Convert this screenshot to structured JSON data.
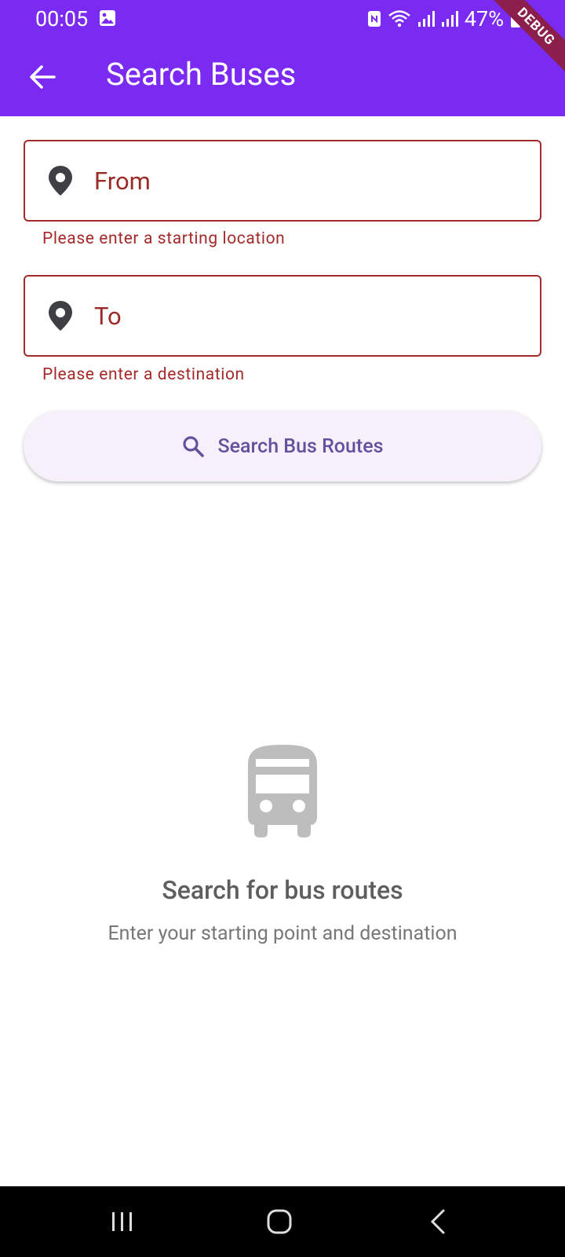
{
  "status_bar": {
    "time": "00:05",
    "battery": "47%",
    "debug_label": "DEBUG",
    "icons": [
      "image-icon",
      "nfc-icon",
      "wifi-icon",
      "signal-icon",
      "signal-icon",
      "battery-icon"
    ]
  },
  "app_bar": {
    "title": "Search Buses",
    "back_icon": "arrow-left-icon",
    "background_color": "#7b2af2"
  },
  "form": {
    "from": {
      "placeholder": "From",
      "value": "",
      "error": "Please enter a starting location",
      "icon": "location-pin-icon"
    },
    "to": {
      "placeholder": "To",
      "value": "",
      "error": "Please enter a destination",
      "icon": "location-pin-icon"
    },
    "error_color": "#a52a2a",
    "search_button": {
      "label": "Search Bus Routes",
      "icon": "search-icon"
    }
  },
  "empty_state": {
    "icon": "bus-icon",
    "title": "Search for bus routes",
    "subtitle": "Enter your starting point and destination"
  },
  "nav_bar": {
    "icons": [
      "recents-icon",
      "home-icon",
      "back-icon"
    ]
  }
}
